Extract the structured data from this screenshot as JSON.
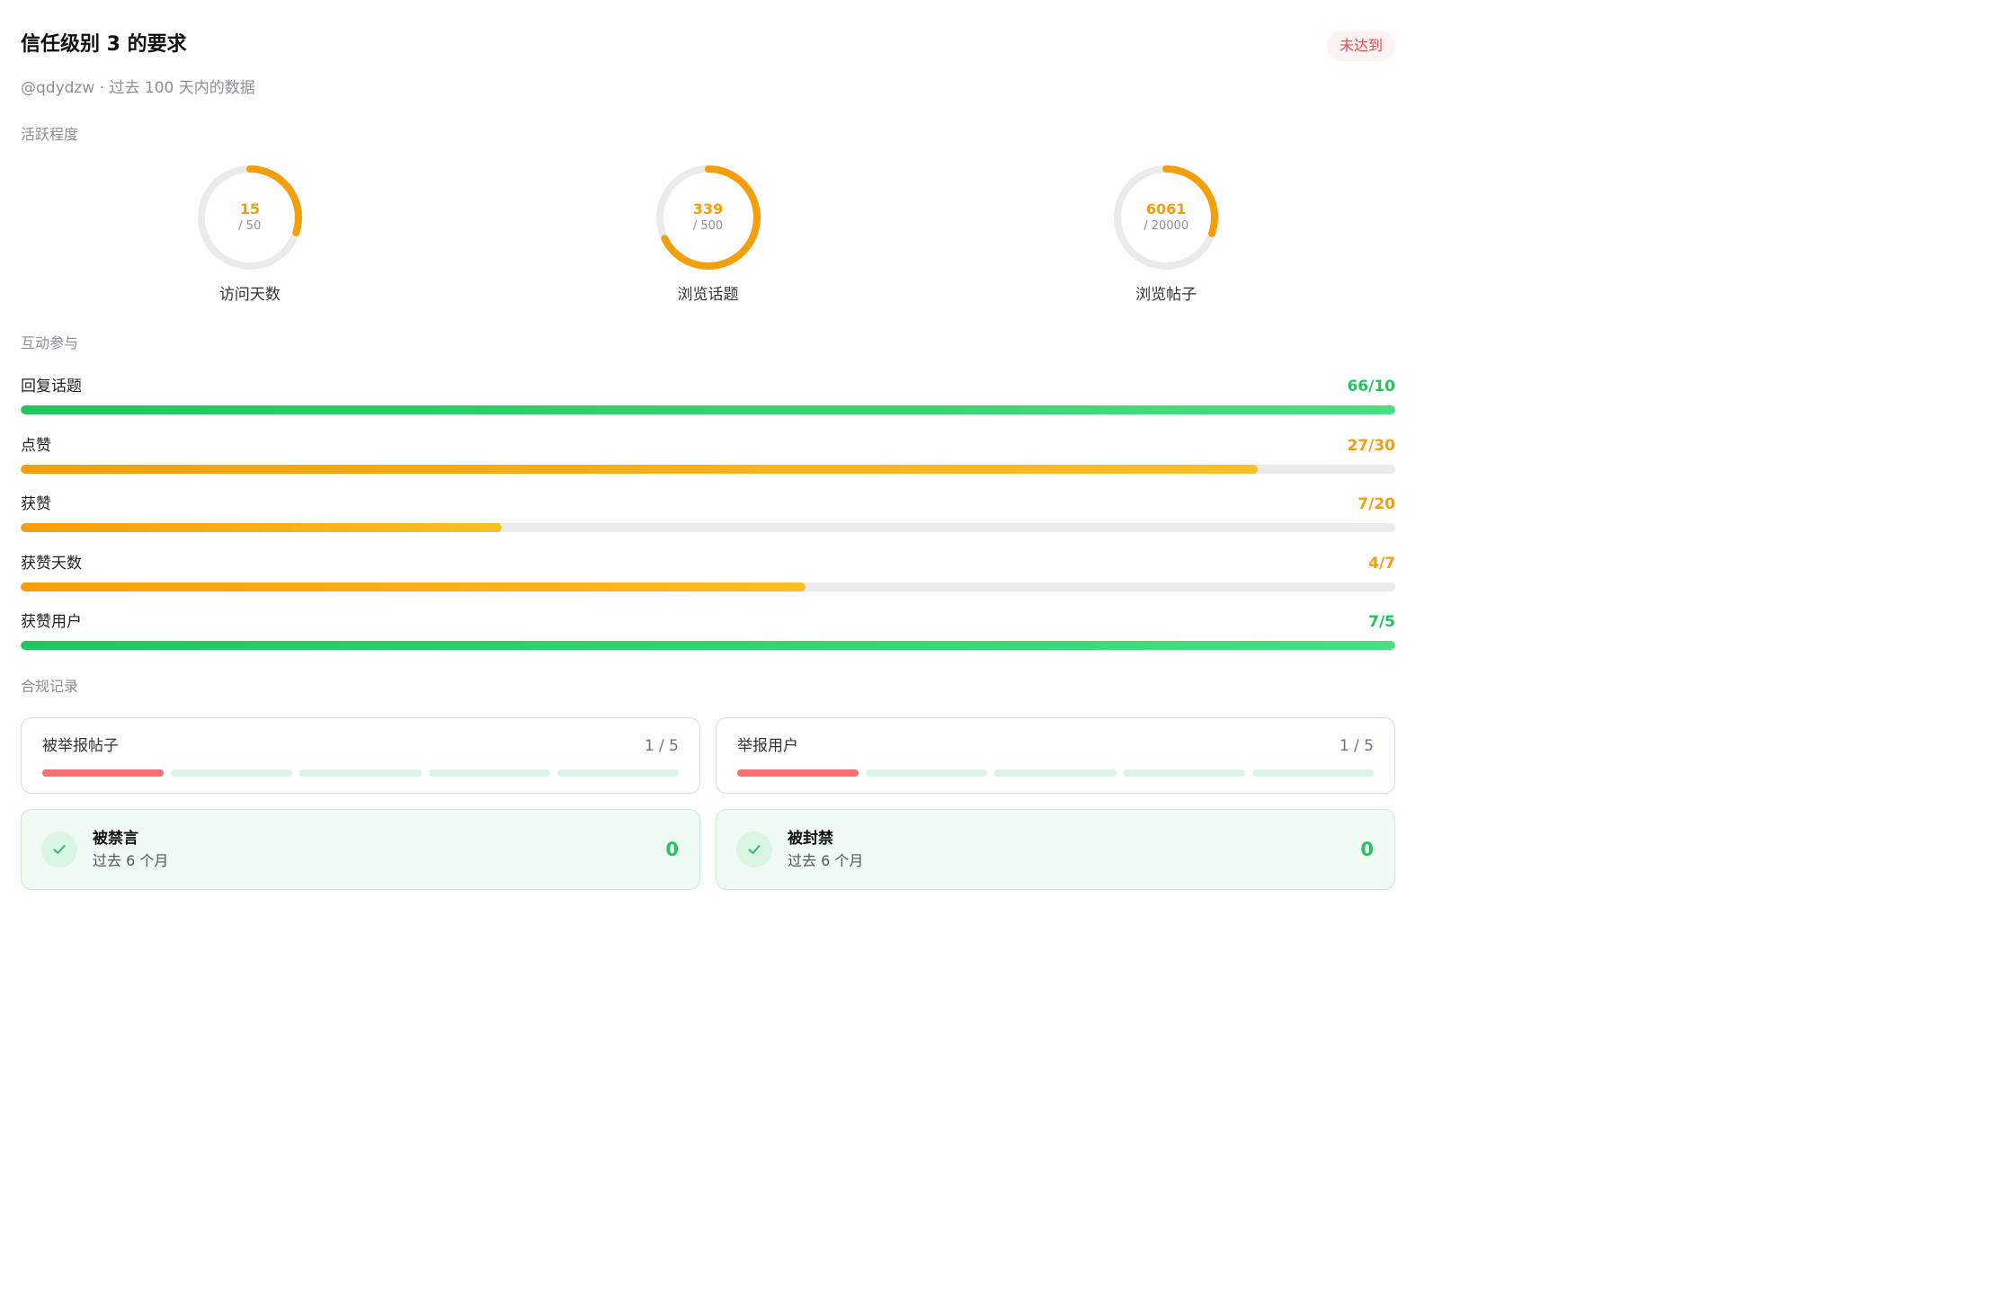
{
  "header": {
    "title": "信任级别 3 的要求",
    "status": "未达到",
    "subtitle": "@qdydzw · 过去 100 天内的数据"
  },
  "sections": {
    "activity": "活跃程度",
    "engagement": "互动参与",
    "compliance": "合规记录"
  },
  "colors": {
    "met": "#22c55e",
    "unmet": "#f59e0b",
    "flagged": "#f87171",
    "status_unmet": "#e5484d"
  },
  "gauges": [
    {
      "label": "访问天数",
      "value": "15",
      "target": "/ 50",
      "fraction": 0.3
    },
    {
      "label": "浏览话题",
      "value": "339",
      "target": "/ 500",
      "fraction": 0.678
    },
    {
      "label": "浏览帖子",
      "value": "6061",
      "target": "/ 20000",
      "fraction": 0.303
    }
  ],
  "bars": [
    {
      "label": "回复话题",
      "display": "66/10",
      "fraction": 1.0,
      "met": true
    },
    {
      "label": "点赞",
      "display": "27/30",
      "fraction": 0.9,
      "met": false
    },
    {
      "label": "获赞",
      "display": "7/20",
      "fraction": 0.35,
      "met": false
    },
    {
      "label": "获赞天数",
      "display": "4/7",
      "fraction": 0.571,
      "met": false
    },
    {
      "label": "获赞用户",
      "display": "7/5",
      "fraction": 1.0,
      "met": true
    }
  ],
  "reports": [
    {
      "title": "被举报帖子",
      "count": "1 / 5",
      "used": 1,
      "max": 5
    },
    {
      "title": "举报用户",
      "count": "1 / 5",
      "used": 1,
      "max": 5
    }
  ],
  "records": [
    {
      "title": "被禁言",
      "desc": "过去 6 个月",
      "value": "0",
      "icon": "check-icon"
    },
    {
      "title": "被封禁",
      "desc": "过去 6 个月",
      "value": "0",
      "icon": "check-icon"
    }
  ]
}
